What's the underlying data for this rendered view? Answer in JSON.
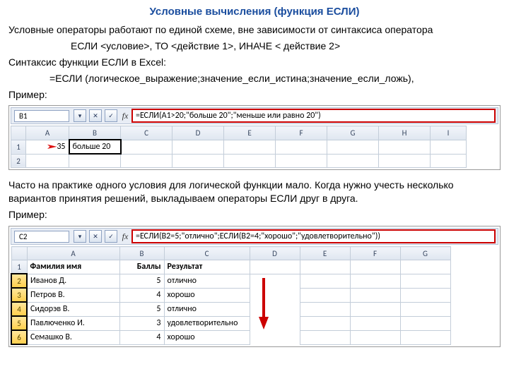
{
  "title": "Условные вычисления (функция ЕСЛИ)",
  "p1": "Условные операторы работают по единой схеме, вне зависимости от синтаксиса оператора",
  "p2": "ЕСЛИ <условие>, ТО <действие 1>, ИНАЧЕ < действие 2>",
  "p3": "Синтаксис функции ЕСЛИ в Excel:",
  "p4": "=ЕСЛИ (логическое_выражение;значение_если_истина;значение_если_ложь),",
  "p5": "Пример:",
  "ex1": {
    "cellref": "B1",
    "formula": "=ЕСЛИ(A1>20;\"больше 20\";\"меньше или равно 20\")",
    "cols": [
      "A",
      "B",
      "C",
      "D",
      "E",
      "F",
      "G",
      "H",
      "I"
    ],
    "rows": [
      [
        "35",
        "больше 20",
        "",
        "",
        "",
        "",
        "",
        "",
        ""
      ],
      [
        "",
        "",
        "",
        "",
        "",
        "",
        "",
        "",
        ""
      ]
    ]
  },
  "p6": "Часто на практике одного условия для логической функции мало. Когда нужно учесть несколько вариантов принятия решений, выкладываем операторы ЕСЛИ друг в друга.",
  "p7": "Пример:",
  "ex2": {
    "cellref": "C2",
    "formula": "=ЕСЛИ(B2=5;\"отлично\";ЕСЛИ(B2=4;\"хорошо\";\"удовлетворительно\"))",
    "cols": [
      "A",
      "B",
      "C",
      "D",
      "E",
      "F",
      "G"
    ],
    "header": [
      "Фамилия имя",
      "Баллы",
      "Результат",
      "",
      "",
      "",
      ""
    ],
    "rows": [
      [
        "Иванов Д.",
        "5",
        "отлично",
        "",
        "",
        "",
        ""
      ],
      [
        "Петров В.",
        "4",
        "хорошо",
        "",
        "",
        "",
        ""
      ],
      [
        "Сидорэв В.",
        "5",
        "отлично",
        "",
        "",
        "",
        ""
      ],
      [
        "Павлюченко И.",
        "3",
        "удовлетворительно",
        "",
        "",
        "",
        ""
      ],
      [
        "Семашко В.",
        "4",
        "хорошо",
        "",
        "",
        "",
        ""
      ]
    ]
  }
}
